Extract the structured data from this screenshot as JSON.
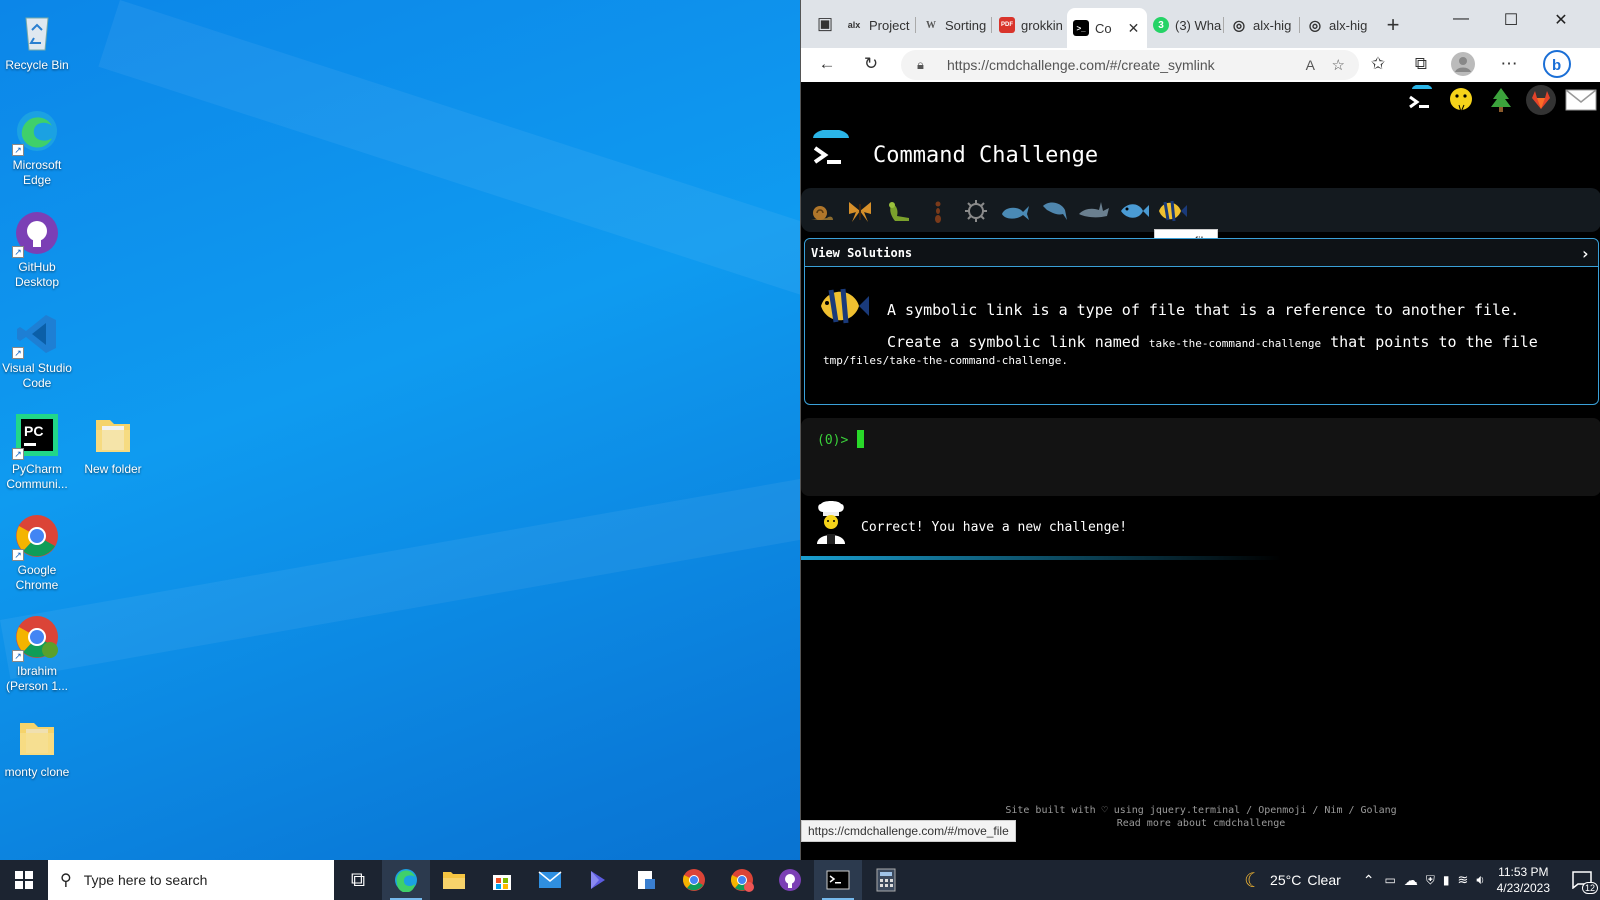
{
  "desktop": {
    "icons": [
      {
        "label": "Recycle Bin",
        "icon": "recycle-bin-icon"
      },
      {
        "label": "Microsoft Edge",
        "icon": "edge-icon"
      },
      {
        "label": "GitHub Desktop",
        "icon": "github-desktop-icon"
      },
      {
        "label": "Visual Studio Code",
        "icon": "vscode-icon"
      },
      {
        "label": "PyCharm Communi...",
        "icon": "pycharm-icon"
      },
      {
        "label": "New folder",
        "icon": "folder-icon"
      },
      {
        "label": "Google Chrome",
        "icon": "chrome-icon"
      },
      {
        "label": "Ibrahim (Person 1...",
        "icon": "chrome-profile-icon"
      },
      {
        "label": "monty clone",
        "icon": "folder-icon"
      }
    ]
  },
  "browser": {
    "tabs": [
      {
        "label": "Project",
        "icon": "alx-icon",
        "fav": "alx"
      },
      {
        "label": "Sorting",
        "icon": "wikipedia-icon",
        "fav": "W"
      },
      {
        "label": "grokkin",
        "icon": "pdf-icon",
        "fav": "PDF"
      },
      {
        "label": "Co",
        "icon": "terminal-icon",
        "fav": ">_"
      },
      {
        "label": "(3) Wha",
        "icon": "whatsapp-icon",
        "fav": "3"
      },
      {
        "label": "alx-hig",
        "icon": "github-icon",
        "fav": "◎"
      },
      {
        "label": "alx-hig",
        "icon": "github-icon",
        "fav": "◎"
      }
    ],
    "url": "https://cmdchallenge.com/#/create_symlink",
    "status_url": "https://cmdchallenge.com/#/move_file"
  },
  "page": {
    "title": "Command Challenge",
    "tooltip": "move file",
    "view_solutions": "View Solutions",
    "challenge_text": "A symbolic link is a type of file that is a reference to another file.",
    "create_prefix": "Create a symbolic link named",
    "link_name": "take-the-command-challenge",
    "create_middle": "that points to the file",
    "target_file": "tmp/files/take-the-command-challenge.",
    "prompt": "(0)>",
    "correct_message": "Correct! You have a new challenge!",
    "footer_line1": "Site built with ♡ using jquery.terminal / Openmoji / Nim / Golang",
    "footer_line2": "Read more about cmdchallenge"
  },
  "taskbar": {
    "search_placeholder": "Type here to search",
    "weather_temp": "25°C",
    "weather_desc": "Clear",
    "time": "11:53 PM",
    "date": "4/23/2023",
    "notif_count": "12"
  },
  "colors": {
    "terminal_green": "#29d829",
    "accent_blue": "#3aa0d8"
  }
}
